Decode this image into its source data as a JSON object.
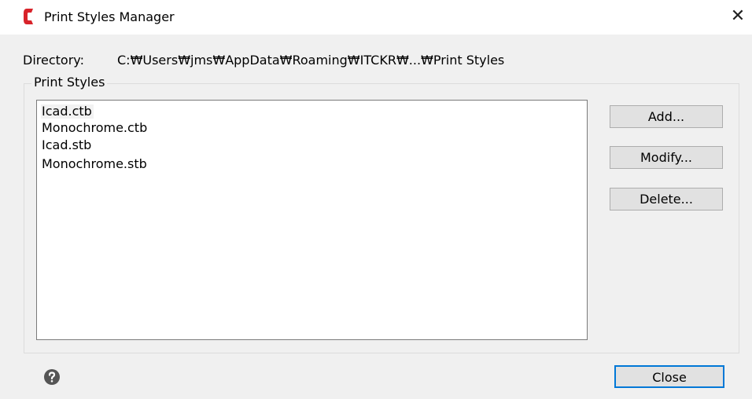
{
  "window": {
    "title": "Print Styles Manager",
    "close_glyph": "✕"
  },
  "directory": {
    "label": "Directory:",
    "value": "C:₩Users₩jms₩AppData₩Roaming₩ITCKR₩...₩Print Styles"
  },
  "print_styles": {
    "group_label": "Print Styles",
    "items": [
      {
        "label": "Icad.ctb",
        "selected": true
      },
      {
        "label": "Monochrome.ctb",
        "selected": false
      },
      {
        "label": "Icad.stb",
        "selected": false
      },
      {
        "label": "Monochrome.stb",
        "selected": false
      }
    ]
  },
  "buttons": {
    "add": "Add...",
    "modify": "Modify...",
    "delete": "Delete...",
    "close": "Close"
  },
  "icons": {
    "app_logo": "app-logo-icon",
    "help": "help-icon",
    "close": "close-icon"
  },
  "colors": {
    "brand_red": "#d8232a",
    "focus_border": "#0078d7"
  }
}
